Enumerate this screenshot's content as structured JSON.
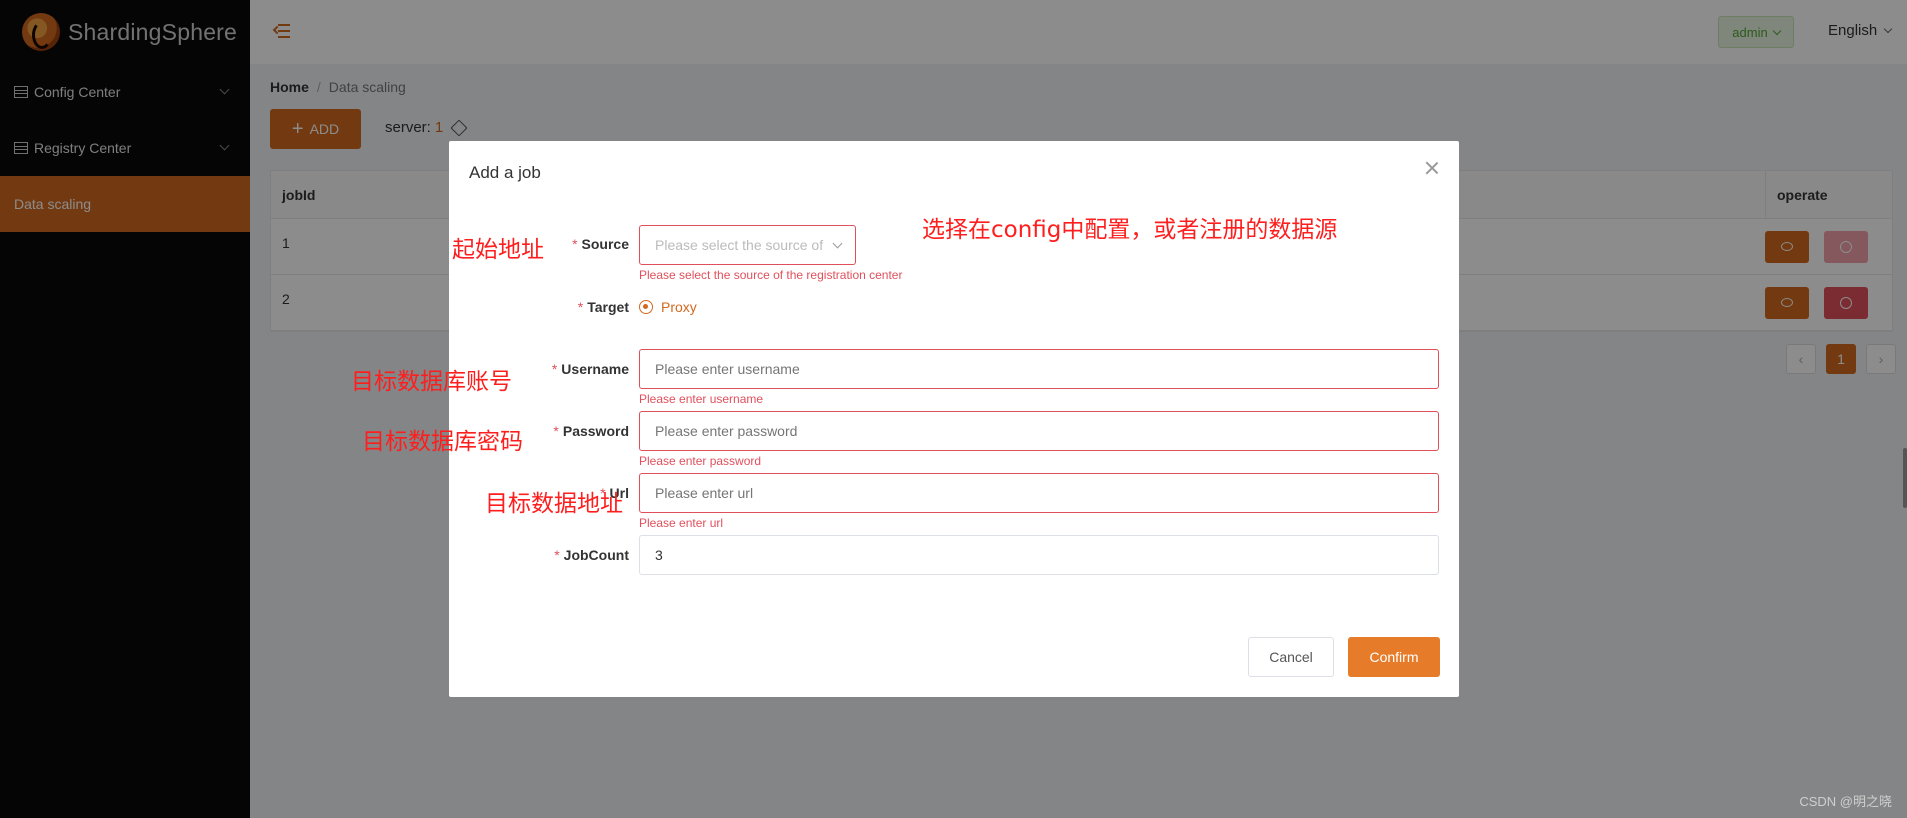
{
  "app": {
    "logo_text": "ShardingSphere"
  },
  "sidebar": {
    "items": [
      {
        "label": "Config Center"
      },
      {
        "label": "Registry Center"
      },
      {
        "label": "Data scaling"
      }
    ]
  },
  "header": {
    "user": "admin",
    "language": "English"
  },
  "breadcrumb": {
    "home": "Home",
    "current": "Data scaling"
  },
  "toolbar": {
    "add_label": "ADD",
    "server_label": "server:",
    "server_value": "1"
  },
  "table": {
    "columns": [
      "jobId",
      "operate"
    ],
    "rows": [
      {
        "jobId": "1"
      },
      {
        "jobId": "2"
      }
    ]
  },
  "pagination": {
    "prev": "‹",
    "current": "1",
    "next": "›"
  },
  "modal": {
    "title": "Add a job",
    "source": {
      "label": "Source",
      "placeholder": "Please select the source of",
      "error": "Please select the source of the registration center"
    },
    "target": {
      "label": "Target",
      "option": "Proxy"
    },
    "username": {
      "label": "Username",
      "placeholder": "Please enter username",
      "error": "Please enter username"
    },
    "password": {
      "label": "Password",
      "placeholder": "Please enter password",
      "error": "Please enter password"
    },
    "url": {
      "label": "Url",
      "placeholder": "Please enter url",
      "error": "Please enter url"
    },
    "jobcount": {
      "label": "JobCount",
      "value": "3"
    },
    "cancel_label": "Cancel",
    "confirm_label": "Confirm",
    "required_mark": "*"
  },
  "annotations": {
    "source_note": "起始地址",
    "config_note": "选择在config中配置，或者注册的数据源",
    "username_note": "目标数据库账号",
    "password_note": "目标数据库密码",
    "url_note": "目标数据地址"
  },
  "watermark": "CSDN @明之晓",
  "colors": {
    "accent": "#d2691e",
    "error": "#e0505c",
    "annotation": "#ff1e1e"
  }
}
